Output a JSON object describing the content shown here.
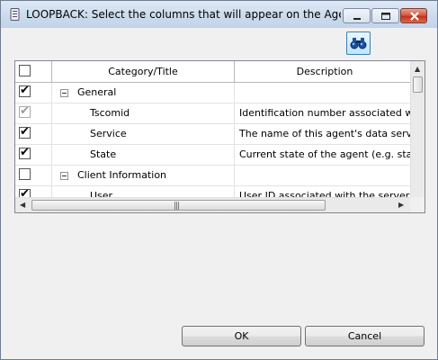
{
  "window": {
    "title": "LOOPBACK: Select the columns that will appear on the Agents p..."
  },
  "toolbar": {
    "find_icon": "binoculars-icon"
  },
  "grid": {
    "columns": {
      "check": "",
      "category": "Category/Title",
      "description": "Description"
    },
    "rows": [
      {
        "type": "group",
        "checked": true,
        "disabled": false,
        "title": "General",
        "description": ""
      },
      {
        "type": "item",
        "checked": true,
        "disabled": true,
        "title": "Tscomid",
        "description": "Identification number associated wi"
      },
      {
        "type": "item",
        "checked": true,
        "disabled": false,
        "title": "Service",
        "description": "The name of this agent's data servic"
      },
      {
        "type": "item",
        "checked": true,
        "disabled": false,
        "title": "State",
        "description": "Current state of the agent (e.g. start"
      },
      {
        "type": "group",
        "checked": false,
        "disabled": false,
        "title": "Client Information",
        "description": ""
      },
      {
        "type": "item",
        "checked": true,
        "disabled": false,
        "title": "User",
        "description": "User ID associated with the server co"
      }
    ]
  },
  "buttons": {
    "ok": "OK",
    "cancel": "Cancel"
  },
  "colors": {
    "title_bar": "#cddcee",
    "dialog_bg": "#f0f0f0",
    "close_button": "#c2341c"
  }
}
